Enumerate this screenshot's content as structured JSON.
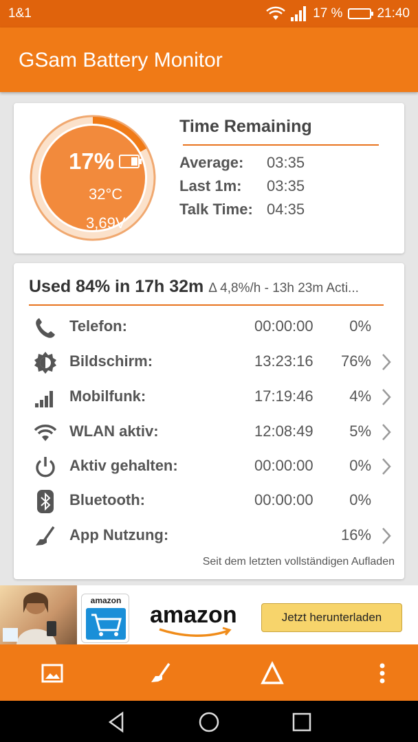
{
  "status_bar": {
    "carrier": "1&1",
    "battery_text": "17 %",
    "time": "21:40"
  },
  "app": {
    "title": "GSam Battery Monitor"
  },
  "gauge": {
    "percent_text": "17%",
    "percent_value": 17,
    "temperature": "32°C",
    "voltage": "3,69V",
    "accent_color": "#f07a16",
    "fill_color": "#f28a3c"
  },
  "time_remaining": {
    "title": "Time Remaining",
    "rows": [
      {
        "label": "Average:",
        "value": "03:35"
      },
      {
        "label": "Last 1m:",
        "value": "03:35"
      },
      {
        "label": "Talk Time:",
        "value": "04:35"
      }
    ]
  },
  "usage": {
    "title": "Used 84% in 17h 32m",
    "subtitle": "Δ 4,8%/h - 13h 23m Acti...",
    "rows": [
      {
        "icon": "phone-icon",
        "name": "Telefon:",
        "time": "00:00:00",
        "percent": "0%",
        "chevron": false
      },
      {
        "icon": "screen-brightness-icon",
        "name": "Bildschirm:",
        "time": "13:23:16",
        "percent": "76%",
        "chevron": true
      },
      {
        "icon": "cell-signal-icon",
        "name": "Mobilfunk:",
        "time": "17:19:46",
        "percent": "4%",
        "chevron": true
      },
      {
        "icon": "wifi-icon",
        "name": "WLAN aktiv:",
        "time": "12:08:49",
        "percent": "5%",
        "chevron": true
      },
      {
        "icon": "power-icon",
        "name": "Aktiv gehalten:",
        "time": "00:00:00",
        "percent": "0%",
        "chevron": true
      },
      {
        "icon": "bluetooth-icon",
        "name": "Bluetooth:",
        "time": "00:00:00",
        "percent": "0%",
        "chevron": false
      },
      {
        "icon": "app-usage-icon",
        "name": "App Nutzung:",
        "time": "",
        "percent": "16%",
        "chevron": true
      }
    ],
    "footnote": "Seit dem letzten vollständigen Aufladen"
  },
  "ad": {
    "logo_small": "amazon",
    "brand": "amazon",
    "button": "Jetzt herunterladen"
  },
  "bottom_nav": [
    {
      "icon": "image-icon"
    },
    {
      "icon": "app-usage-icon"
    },
    {
      "icon": "delta-icon"
    },
    {
      "icon": "overflow-menu-icon"
    }
  ],
  "colors": {
    "status_bar": "#e0630c",
    "app_bar": "#f07a16",
    "divider": "#e8731c"
  }
}
